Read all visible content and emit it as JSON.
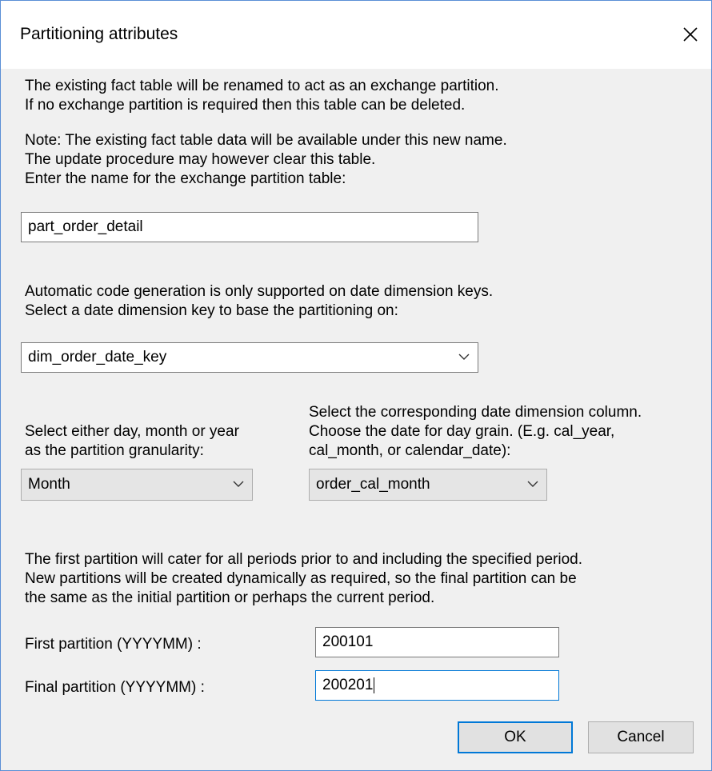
{
  "dialog": {
    "title": "Partitioning attributes",
    "intro_line1": "The existing fact table will be renamed to act as an exchange partition.",
    "intro_line2": "If no exchange partition is required then this table can be deleted.",
    "note_line1": "Note: The existing fact table data will be available under this new name.",
    "note_line2": "The update procedure may however clear this table.",
    "note_line3": "Enter the name for the exchange partition table:",
    "exchange_table_value": "part_order_detail",
    "auto_line1": "Automatic code generation is only supported on date dimension keys.",
    "auto_line2": "Select a date dimension key to base the partitioning on:",
    "date_key_selected": "dim_order_date_key",
    "granularity_line1": "Select either day, month or year",
    "granularity_line2": "as the partition granularity:",
    "granularity_selected": "Month",
    "column_line1": "Select the corresponding date dimension column.",
    "column_line2": "Choose the date for day grain. (E.g. cal_year,",
    "column_line3": "cal_month, or calendar_date):",
    "column_selected": "order_cal_month",
    "first_info_line1": "The first partition will cater for all periods prior to and including the specified period.",
    "first_info_line2": "New partitions will be created dynamically as required, so the final partition can be",
    "first_info_line3": "the same as the initial partition or perhaps the current period.",
    "first_partition_label": "First partition (YYYYMM) :",
    "first_partition_value": "200101",
    "final_partition_label": "Final partition (YYYYMM) :",
    "final_partition_value": "200201",
    "ok_label": "OK",
    "cancel_label": "Cancel"
  },
  "icons": {
    "close": "close-icon",
    "dropdown": "chevron-down-icon"
  },
  "colors": {
    "accent": "#0078d7",
    "dialog_bg": "#f0f0f0"
  }
}
